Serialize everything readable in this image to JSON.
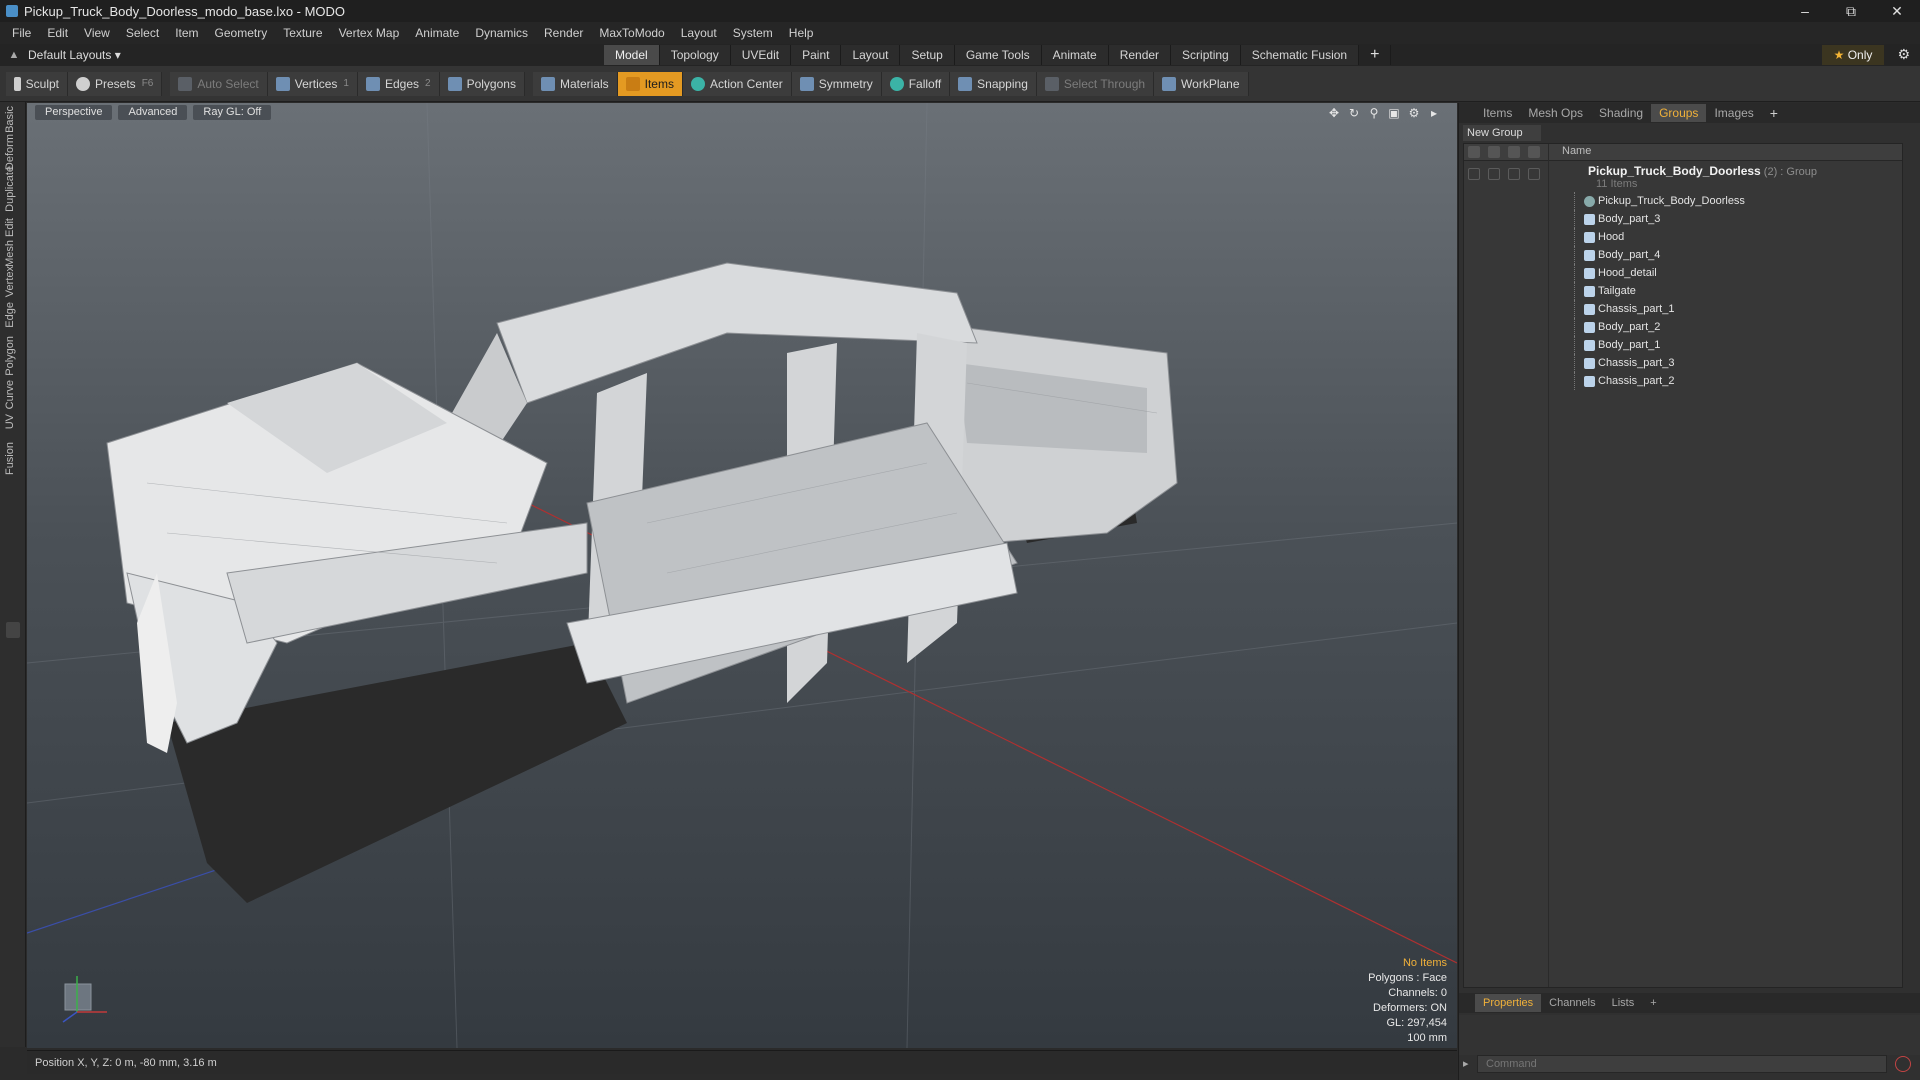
{
  "window": {
    "title": "Pickup_Truck_Body_Doorless_modo_base.lxo - MODO",
    "controls": [
      "–",
      "⧉",
      "✕"
    ]
  },
  "menu": [
    "File",
    "Edit",
    "View",
    "Select",
    "Item",
    "Geometry",
    "Texture",
    "Vertex Map",
    "Animate",
    "Dynamics",
    "Render",
    "MaxToModo",
    "Layout",
    "System",
    "Help"
  ],
  "layoutbar": {
    "layout_select": "Default Layouts ▾",
    "tabs": [
      "Model",
      "Topology",
      "UVEdit",
      "Paint",
      "Layout",
      "Setup",
      "Game Tools",
      "Animate",
      "Render",
      "Scripting",
      "Schematic Fusion"
    ],
    "active_tab": "Model",
    "plus": "+",
    "only_label": "Only",
    "star": "★"
  },
  "toolbar": {
    "sculpt": "Sculpt",
    "presets": "Presets",
    "presets_key": "F6",
    "auto_select": "Auto Select",
    "vertices": "Vertices",
    "vertices_key": "1",
    "edges": "Edges",
    "edges_key": "2",
    "polygons": "Polygons",
    "materials": "Materials",
    "items": "Items",
    "action_center": "Action Center",
    "symmetry": "Symmetry",
    "falloff": "Falloff",
    "snapping": "Snapping",
    "select_through": "Select Through",
    "workplane": "WorkPlane"
  },
  "left_tabs": [
    "Basic",
    "Deform",
    "Duplicate",
    "Mesh Edit",
    "Vertex",
    "Edge",
    "Polygon",
    "Curve",
    "UV",
    "Fusion"
  ],
  "viewport": {
    "perspective": "Perspective",
    "advanced": "Advanced",
    "raygl": "Ray GL: Off",
    "info": {
      "no_items": "No Items",
      "polygons": "Polygons : Face",
      "channels": "Channels: 0",
      "deformers": "Deformers: ON",
      "gl": "GL: 297,454",
      "scale": "100 mm"
    }
  },
  "statusbar": {
    "position": "Position X, Y, Z:  0 m, -80 mm, 3.16 m"
  },
  "right_panel": {
    "tabs": [
      "Items",
      "Mesh Ops",
      "Shading",
      "Groups",
      "Images"
    ],
    "active_tab": "Groups",
    "plus": "+",
    "new_group": "New Group",
    "name_header": "Name",
    "group": {
      "name": "Pickup_Truck_Body_Doorless",
      "suffix": " (2) : Group",
      "count": "11 Items"
    },
    "items": [
      {
        "label": "Pickup_Truck_Body_Doorless",
        "kind": "locator"
      },
      {
        "label": "Body_part_3",
        "kind": "mesh"
      },
      {
        "label": "Hood",
        "kind": "mesh"
      },
      {
        "label": "Body_part_4",
        "kind": "mesh"
      },
      {
        "label": "Hood_detail",
        "kind": "mesh"
      },
      {
        "label": "Tailgate",
        "kind": "mesh"
      },
      {
        "label": "Chassis_part_1",
        "kind": "mesh"
      },
      {
        "label": "Body_part_2",
        "kind": "mesh"
      },
      {
        "label": "Body_part_1",
        "kind": "mesh"
      },
      {
        "label": "Chassis_part_3",
        "kind": "mesh"
      },
      {
        "label": "Chassis_part_2",
        "kind": "mesh"
      }
    ],
    "bottom_tabs": [
      "Properties",
      "Channels",
      "Lists"
    ],
    "bottom_active": "Properties",
    "command_placeholder": "Command"
  },
  "colors": {
    "accent": "#f0b13a",
    "active_tool": "#e49a22"
  }
}
